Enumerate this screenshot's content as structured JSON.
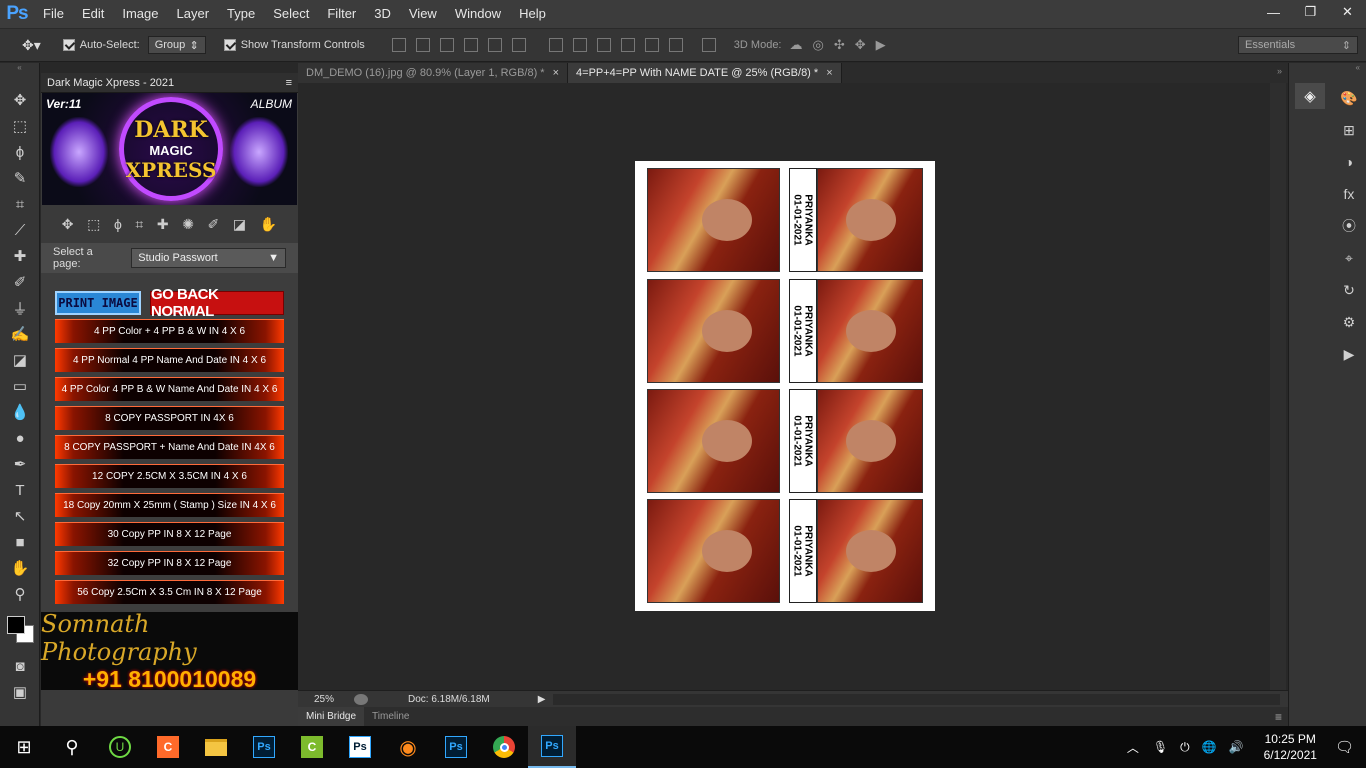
{
  "app": {
    "logo": "Ps"
  },
  "menu": [
    "File",
    "Edit",
    "Image",
    "Layer",
    "Type",
    "Select",
    "Filter",
    "3D",
    "View",
    "Window",
    "Help"
  ],
  "options": {
    "auto_select_label": "Auto-Select:",
    "auto_select_value": "Group",
    "show_transform_label": "Show Transform Controls",
    "mode_label": "3D Mode:",
    "workspace": "Essentials"
  },
  "panel": {
    "title": "Dark Magic Xpress - 2021",
    "banner_version": "Ver:11",
    "banner_album": "ALBUM",
    "banner_line1": "DARK",
    "banner_line2": "MAGIC",
    "banner_line3": "XPRESS",
    "page_label": "Select a page:",
    "page_value": "Studio Passwort",
    "print_btn": "PRINT IMAGE",
    "back_btn": "GO BACK NORMAL",
    "actions": [
      "4 PP Color + 4 PP B & W  IN 4 X 6",
      "4 PP Normal 4 PP Name And Date IN 4 X 6",
      "4 PP Color 4 PP B & W  Name And Date IN 4 X 6",
      "8 COPY  PASSPORT IN 4X 6",
      "8 COPY  PASSPORT + Name And Date IN 4X 6",
      "12 COPY 2.5CM X 3.5CM IN 4 X 6",
      "18 Copy 20mm X 25mm ( Stamp ) Size IN 4 X 6",
      "30 Copy PP IN 8 X 12 Page",
      "32 Copy PP IN 8 X 12 Page",
      "56 Copy 2.5Cm X 3.5 Cm IN 8 X 12 Page"
    ],
    "promo_name": "Somnath Photography",
    "promo_phone": "+91 8100010089"
  },
  "tabs": [
    {
      "label": "DM_DEMO (16).jpg @ 80.9% (Layer 1, RGB/8) *",
      "active": false
    },
    {
      "label": "4=PP+4=PP With NAME DATE @ 25% (RGB/8) *",
      "active": true
    }
  ],
  "document": {
    "name": "PRIYANKA",
    "date": "01-01-2021"
  },
  "status": {
    "zoom": "25%",
    "doc": "Doc: 6.18M/6.18M"
  },
  "bottom_tabs": [
    "Mini Bridge",
    "Timeline"
  ],
  "clock": {
    "time": "10:25 PM",
    "date": "6/12/2021"
  },
  "icons": {
    "close": "×",
    "arrow": "▶"
  }
}
